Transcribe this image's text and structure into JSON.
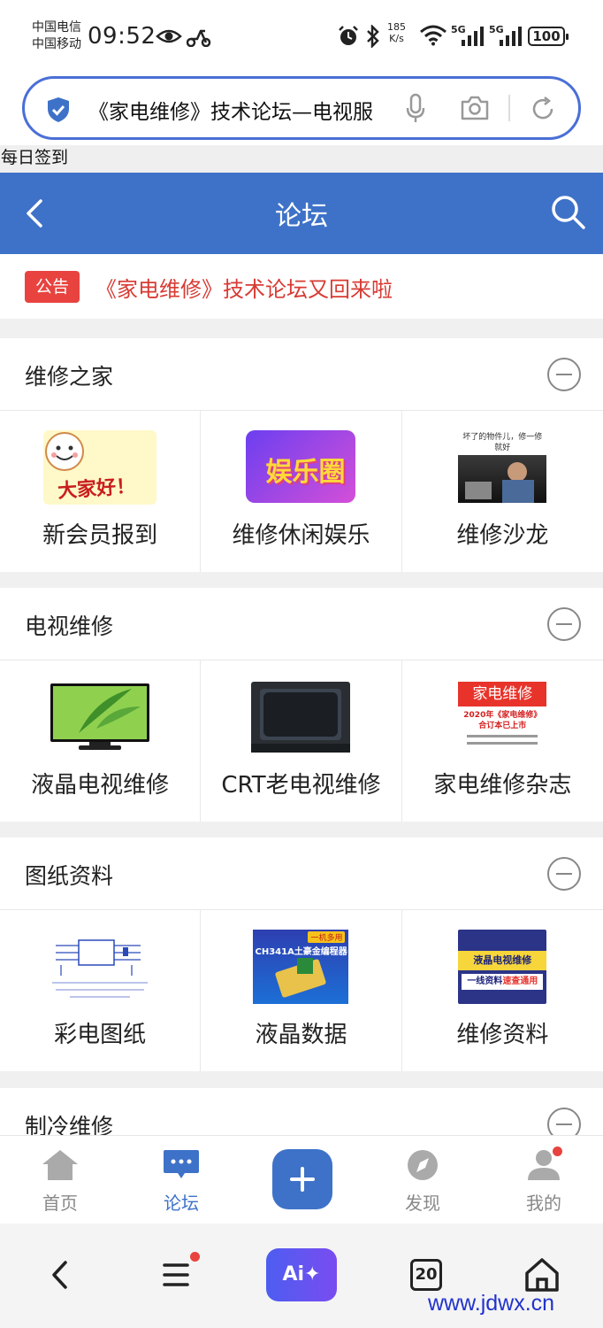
{
  "status_bar": {
    "carrier_1": "中国电信",
    "carrier_2": "中国移动",
    "time": "09:52",
    "net_speed_value": "185",
    "net_speed_unit": "K/s",
    "signal_1": "5G",
    "signal_2": "5G",
    "battery": "100",
    "icons": [
      "eye-icon",
      "scooter-icon",
      "alarm-icon",
      "bluetooth-icon",
      "wifi-icon",
      "signal-icon",
      "battery-icon"
    ]
  },
  "browser": {
    "address_text": "《家电维修》技术论坛—电视服",
    "icons": [
      "shield-icon",
      "mic-icon",
      "camera-icon",
      "reload-icon"
    ]
  },
  "daily_checkin": "每日签到",
  "header": {
    "title": "论坛",
    "color": "#3e72c8"
  },
  "notice": {
    "badge": "公告",
    "text": "《家电维修》技术论坛又回来啦",
    "color": "#d73b33"
  },
  "sections": [
    {
      "title": "维修之家",
      "items": [
        {
          "label": "新会员报到",
          "thumb_text": "大家好！"
        },
        {
          "label": "维修休闲娱乐",
          "thumb_text": "娱乐圈"
        },
        {
          "label": "维修沙龙",
          "thumb_text": "坏了的物件儿，修一修就好"
        }
      ]
    },
    {
      "title": "电视维修",
      "items": [
        {
          "label": "液晶电视维修"
        },
        {
          "label": "CRT老电视维修"
        },
        {
          "label": "家电维修杂志",
          "thumb_text": "家电维修",
          "thumb_sub": "2020年《家电维修》合订本已上市"
        }
      ]
    },
    {
      "title": "图纸资料",
      "items": [
        {
          "label": "彩电图纸"
        },
        {
          "label": "液晶数据",
          "thumb_text": "CH341A土豪金编程器",
          "thumb_tag": "一机多用"
        },
        {
          "label": "维修资料",
          "thumb_text": "液晶电视维修",
          "thumb_sub": "一线资料",
          "thumb_tag": "速查通用"
        }
      ]
    },
    {
      "title": "制冷维修",
      "items": []
    }
  ],
  "tab_bar": {
    "tabs": [
      {
        "label": "首页",
        "icon": "home-icon",
        "active": false
      },
      {
        "label": "论坛",
        "icon": "forum-icon",
        "active": true
      },
      {
        "label": "发现",
        "icon": "compass-icon",
        "active": false
      },
      {
        "label": "我的",
        "icon": "profile-icon",
        "active": false
      }
    ],
    "fab_icon": "plus-icon"
  },
  "nav_bar": {
    "ai_label": "Ai✦",
    "tab_count": "20",
    "icons": [
      "back-icon",
      "menu-icon",
      "ai-icon",
      "tabs-icon",
      "home-icon"
    ]
  },
  "watermark": "www.jdwx.cn"
}
